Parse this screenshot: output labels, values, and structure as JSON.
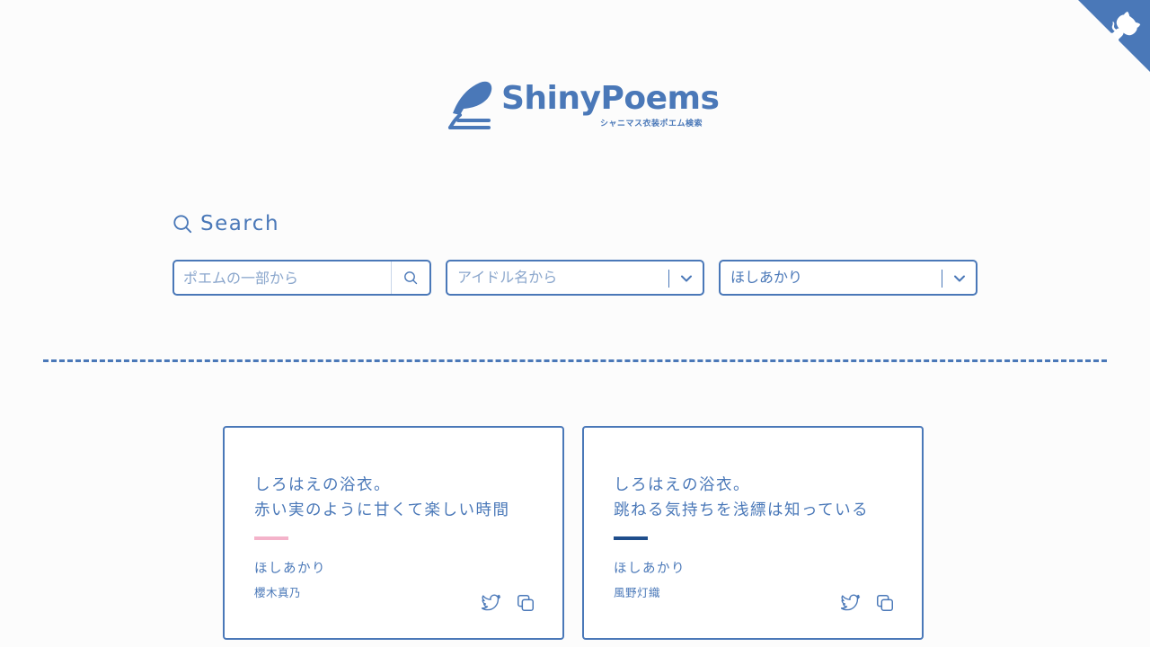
{
  "colors": {
    "primary": "#4a78b8",
    "accent_pink": "#f4b3ca",
    "accent_navy": "#1f4e8c",
    "background": "#fcfcfc"
  },
  "github_corner": {
    "icon": "github-octocat-icon"
  },
  "logo": {
    "title": "ShinyPoems",
    "subtitle": "シャニマス衣装ポエム検索"
  },
  "search": {
    "heading": "Search",
    "poem_input": {
      "placeholder": "ポエムの一部から",
      "value": ""
    },
    "idol_select": {
      "placeholder": "アイドル名から"
    },
    "costume_select": {
      "value": "ほしあかり"
    }
  },
  "results": [
    {
      "poem_lines": [
        "しろはえの浴衣。",
        "赤い実のように甘くて楽しい時間"
      ],
      "accent_color": "#f4b3ca",
      "costume": "ほしあかり",
      "idol": "櫻木真乃"
    },
    {
      "poem_lines": [
        "しろはえの浴衣。",
        "跳ねる気持ちを浅縹は知っている"
      ],
      "accent_color": "#1f4e8c",
      "costume": "ほしあかり",
      "idol": "風野灯織"
    }
  ]
}
